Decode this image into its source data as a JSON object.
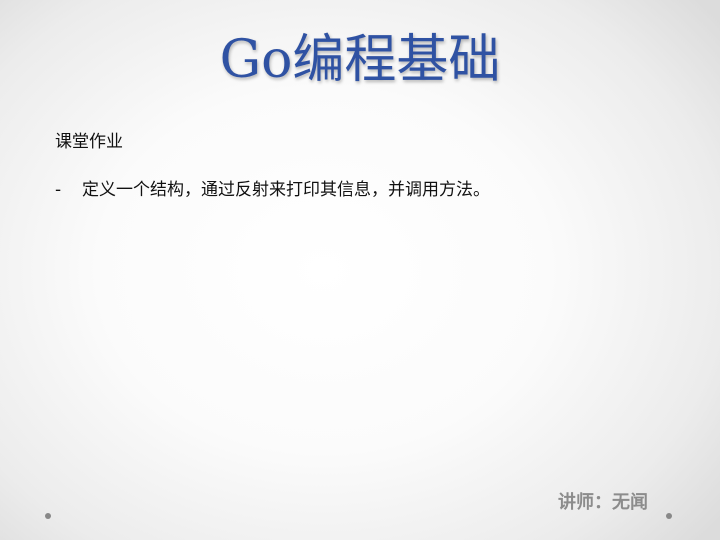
{
  "slide": {
    "title": "Go编程基础",
    "subtitle": "课堂作业",
    "bullets": [
      {
        "marker": "-",
        "text": "定义一个结构，通过反射来打印其信息，并调用方法。"
      }
    ],
    "footer": "讲师：无闻"
  },
  "colors": {
    "title": "#2f52a3",
    "body_text": "#111111",
    "footer_text": "#8c8c8c",
    "dot": "#888888"
  }
}
